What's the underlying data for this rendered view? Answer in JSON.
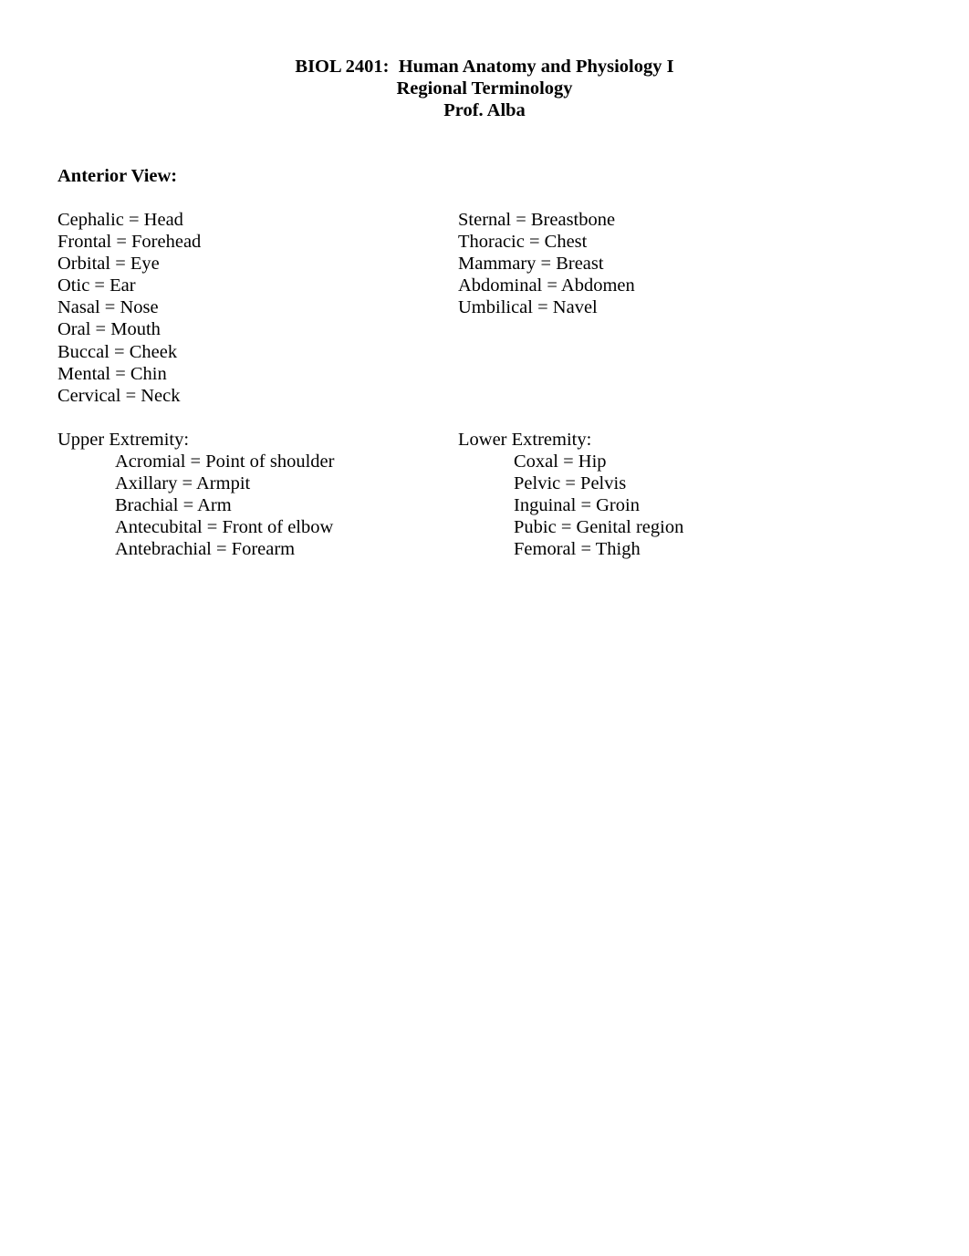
{
  "header": {
    "course": "BIOL 2401:  Human Anatomy and Physiology I",
    "topic": "Regional Terminology",
    "instructor": "Prof. Alba"
  },
  "anterior_view": {
    "heading": "Anterior View:",
    "head_neck_terms": [
      "Cephalic = Head",
      "Frontal = Forehead",
      "Orbital = Eye",
      "Otic = Ear",
      "Nasal = Nose",
      "Oral = Mouth",
      "Buccal = Cheek",
      "Mental = Chin",
      "Cervical = Neck"
    ],
    "trunk_terms": [
      "Sternal = Breastbone",
      "Thoracic = Chest",
      "Mammary = Breast",
      "Abdominal = Abdomen",
      "Umbilical = Navel"
    ],
    "upper_extremity": {
      "heading": "Upper Extremity:",
      "terms": [
        "Acromial = Point of shoulder",
        "Axillary = Armpit",
        "Brachial = Arm",
        "Antecubital = Front of elbow",
        "Antebrachial = Forearm"
      ]
    },
    "lower_extremity": {
      "heading": "Lower Extremity:",
      "terms": [
        "Coxal = Hip",
        "Pelvic = Pelvis",
        "Inguinal = Groin",
        "Pubic = Genital region",
        "Femoral = Thigh"
      ]
    }
  }
}
